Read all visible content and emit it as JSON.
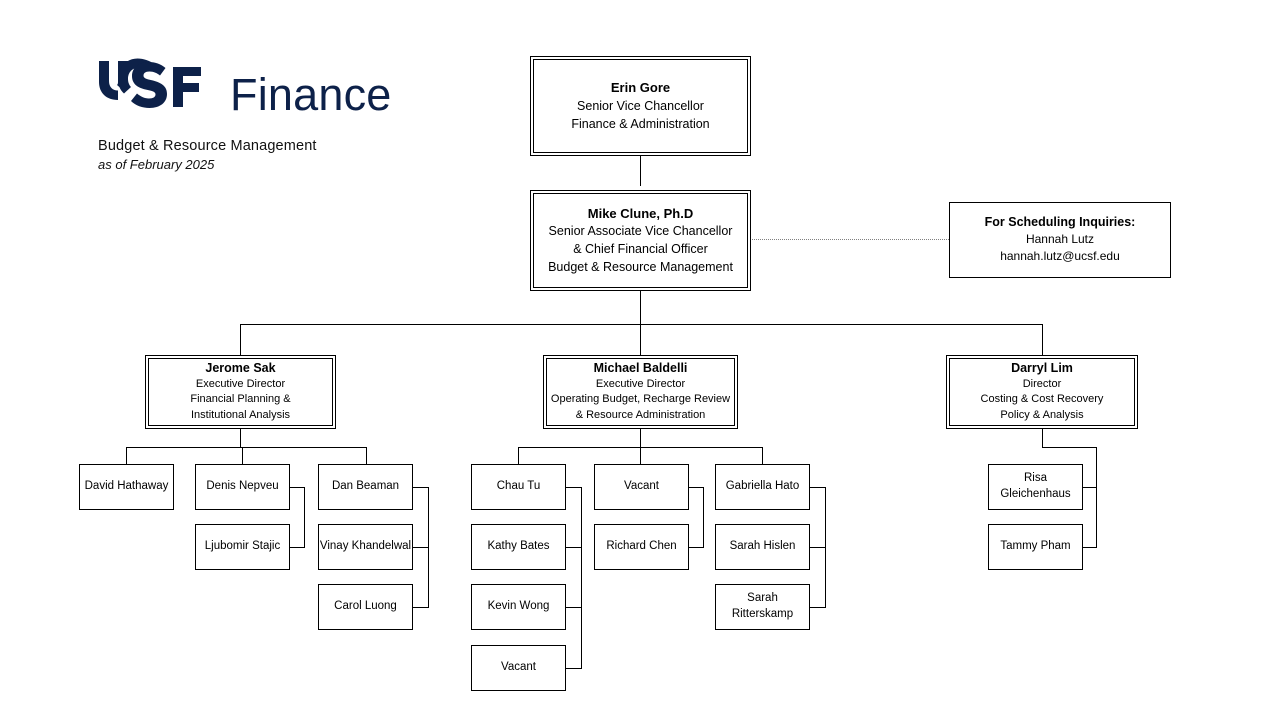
{
  "header": {
    "logo_text_primary": "UCSF",
    "logo_text_secondary": "Finance",
    "unit": "Budget & Resource Management",
    "as_of": "as of February 2025",
    "brand_color": "#0d2149"
  },
  "chart_data": {
    "type": "diagram",
    "title": "UCSF Finance — Budget & Resource Management Organizational Chart"
  },
  "nodes": {
    "evc": {
      "name": "Erin Gore",
      "line1": "Senior Vice Chancellor",
      "line2": "Finance & Administration"
    },
    "cfo": {
      "name": "Mike Clune, Ph.D",
      "line1": "Senior Associate Vice Chancellor",
      "line2": "& Chief Financial Officer",
      "line3": "Budget & Resource Management"
    },
    "scheduling": {
      "name": "For Scheduling Inquiries:",
      "line1": "Hannah Lutz",
      "line2": "hannah.lutz@ucsf.edu"
    },
    "dir_sak": {
      "name": "Jerome Sak",
      "line1": "Executive Director",
      "line2": "Financial Planning &",
      "line3": "Institutional Analysis"
    },
    "dir_baldelli": {
      "name": "Michael Baldelli",
      "line1": "Executive Director",
      "line2": "Operating Budget, Recharge Review",
      "line3": "& Resource Administration"
    },
    "dir_lim": {
      "name": "Darryl Lim",
      "line1": "Director",
      "line2": "Costing & Cost Recovery",
      "line3": "Policy & Analysis"
    },
    "staff": {
      "hathaway": "David Hathaway",
      "nepveu": "Denis Nepveu",
      "stajic": "Ljubomir Stajic",
      "beaman": "Dan Beaman",
      "khandelwal": "Vinay Khandelwal",
      "luong": "Carol Luong",
      "chau_tu": "Chau Tu",
      "kathy_bates": "Kathy Bates",
      "kevin_wong": "Kevin Wong",
      "vacant_tu_col": "Vacant",
      "vacant_mid": "Vacant",
      "richard_chen": "Richard Chen",
      "gabriella_hato": "Gabriella Hato",
      "sarah_hislen": "Sarah Hislen",
      "sarah_ritterskamp_l1": "Sarah",
      "sarah_ritterskamp_l2": "Ritterskamp",
      "risa_l1": "Risa",
      "risa_l2": "Gleichenhaus",
      "tammy_pham": "Tammy Pham"
    }
  }
}
